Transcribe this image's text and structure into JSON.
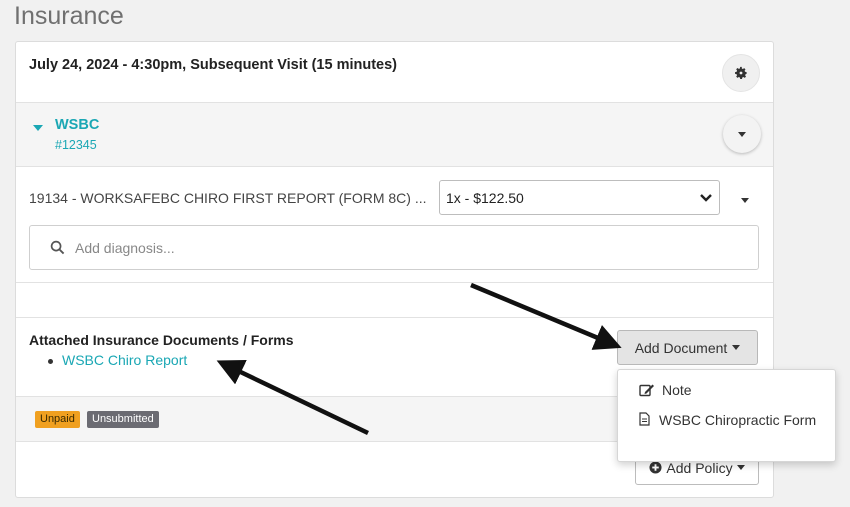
{
  "page": {
    "title": "Insurance"
  },
  "visit": {
    "title": "July 24, 2024 - 4:30pm, Subsequent Visit (15 minutes)"
  },
  "policy": {
    "name": "WSBC",
    "number": "#12345"
  },
  "billing": {
    "code_label": "19134 - WORKSAFEBC CHIRO FIRST REPORT (FORM 8C) ...",
    "quantity_select": "1x - $122.50"
  },
  "diagnosis": {
    "placeholder": "Add diagnosis..."
  },
  "documents": {
    "title": "Attached Insurance Documents / Forms",
    "items": [
      "WSBC Chiro Report"
    ],
    "add_button": "Add Document"
  },
  "status": {
    "badges": [
      "Unpaid",
      "Unsubmitted"
    ],
    "colors": {
      "unpaid": "#f0a020",
      "unsubmitted": "#6b6b72"
    }
  },
  "add_policy": {
    "label": "Add Policy"
  },
  "menu": {
    "items": [
      "Note",
      "WSBC Chiropractic Form"
    ]
  },
  "colors": {
    "accent": "#1aa7b4"
  },
  "icons": [
    "gear-icon",
    "chevron-down-icon",
    "search-icon",
    "edit-icon",
    "document-icon",
    "plus-circle-icon"
  ]
}
